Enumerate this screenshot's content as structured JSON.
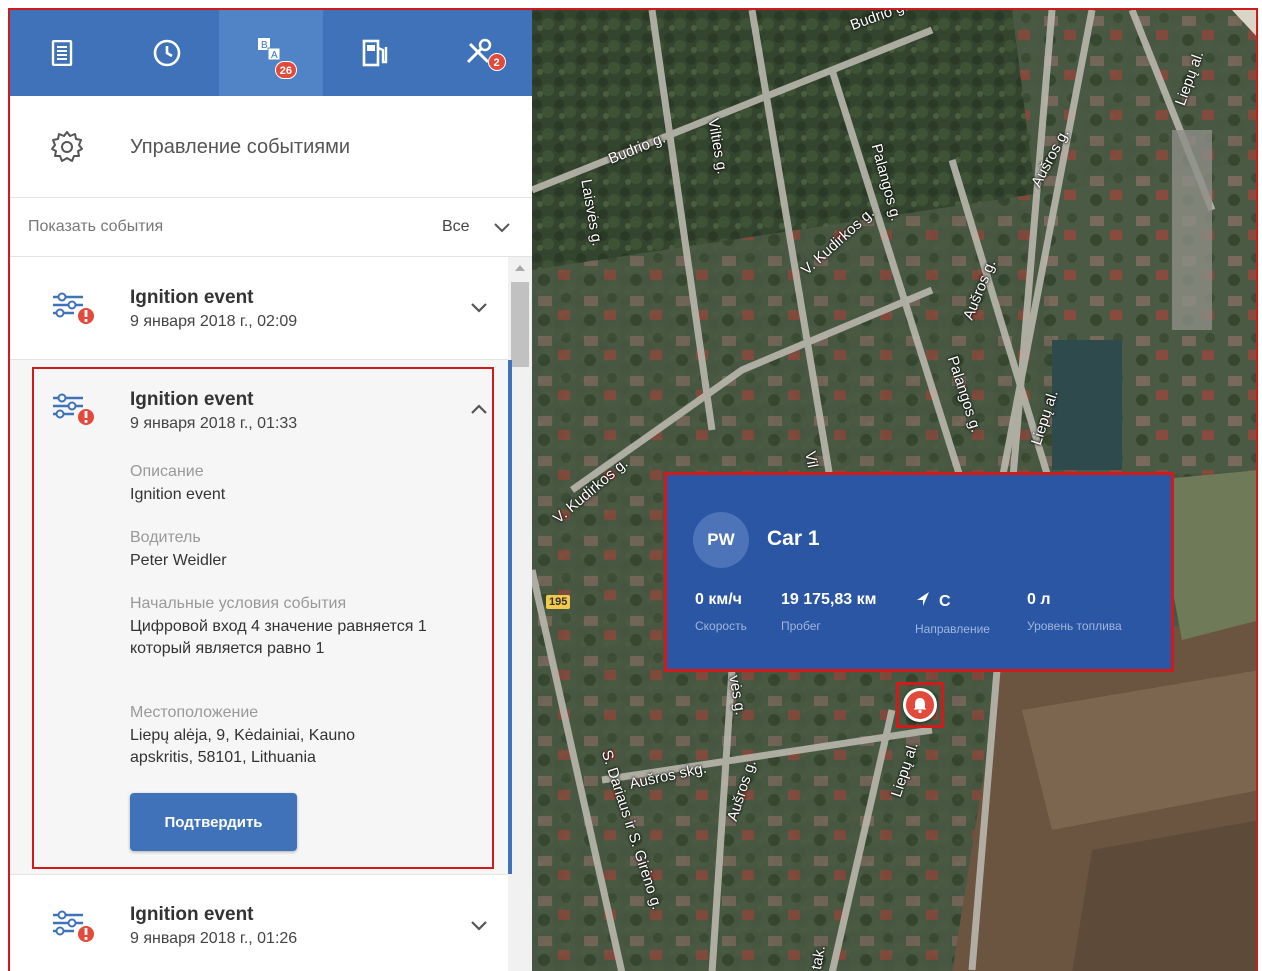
{
  "tabs": [
    {
      "name": "document-tab",
      "icon": "document-icon",
      "badge": ""
    },
    {
      "name": "history-tab",
      "icon": "clock-icon",
      "badge": ""
    },
    {
      "name": "events-tab",
      "icon": "events-icon",
      "badge": "26",
      "active": true
    },
    {
      "name": "fuel-tab",
      "icon": "fuel-pump-icon",
      "badge": ""
    },
    {
      "name": "service-tab",
      "icon": "tools-icon",
      "badge": "2"
    }
  ],
  "management": {
    "label": "Управление событиями"
  },
  "filter": {
    "label": "Показать события",
    "value": "Все"
  },
  "events": [
    {
      "title": "Ignition event",
      "date": "9 января 2018 г., 02:09",
      "expanded": false
    },
    {
      "title": "Ignition event",
      "date": "9 января 2018 г., 01:33",
      "expanded": true,
      "description_label": "Описание",
      "description": "Ignition event",
      "driver_label": "Водитель",
      "driver": "Peter Weidler",
      "conditions_label": "Начальные условия события",
      "conditions": "Цифровой вход 4 значение равняется 1 который является равно 1",
      "location_label": "Местоположение",
      "location": "Liepų alėja, 9, Kėdainiai, Kauno apskritis, 58101, Lithuania",
      "confirm_label": "Подтвердить"
    },
    {
      "title": "Ignition event",
      "date": "9 января 2018 г., 01:26",
      "expanded": false
    }
  ],
  "map": {
    "streets": [
      "Budrio g.",
      "Budrio g.",
      "Vilties g.",
      "Laisvės g.",
      "Palangos g.",
      "V. Kudirkos g.",
      "Aušros g.",
      "Aušros g.",
      "Liepų al.",
      "Liepų al.",
      "Palangos g.",
      "V. Kudirkos g.",
      "Aušros skg.",
      "Aušros g.",
      "S. Dariaus ir S. Girėno g.",
      "Liepų al.",
      "Vil",
      "vės g.",
      "tak."
    ],
    "road_number": "195"
  },
  "vehicle_card": {
    "initials": "PW",
    "name": "Car 1",
    "speed_value": "0 км/ч",
    "speed_label": "Скорость",
    "mileage_value": "19 175,83 км",
    "mileage_label": "Пробег",
    "direction_value": "С",
    "direction_label": "Направление",
    "fuel_value": "0 л",
    "fuel_label": "Уровень топлива"
  },
  "colors": {
    "header": "#3f72b8",
    "card": "#2b56a3",
    "alert": "#e24a3b",
    "frame": "#d11a1a"
  }
}
